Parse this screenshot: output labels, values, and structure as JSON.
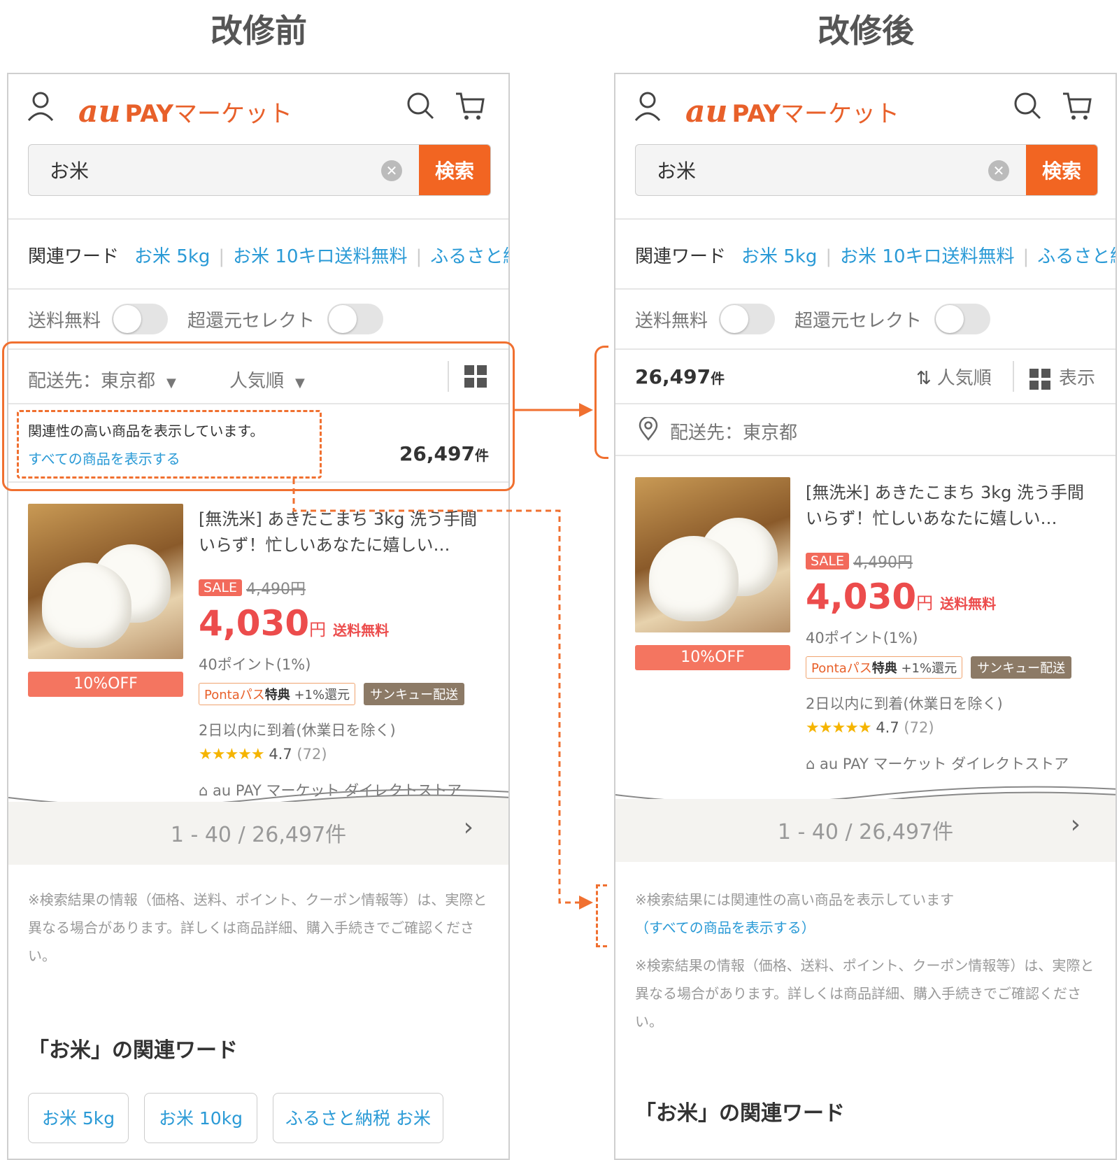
{
  "headings": {
    "before": "改修前",
    "after": "改修後"
  },
  "header": {
    "logo_au": "au",
    "logo_pay": "PAY",
    "logo_market": "マーケット"
  },
  "search": {
    "value": "お米",
    "button": "検索"
  },
  "related": {
    "label": "関連ワード",
    "links": [
      "お米 5kg",
      "お米 10キロ送料無料",
      "ふるさと納"
    ]
  },
  "filters": {
    "free_shipping": "送料無料",
    "super_select": "超還元セレクト"
  },
  "sort_bar": {
    "destination": "配送先：東京都",
    "sort": "人気順",
    "display": "表示",
    "count_num": "26,497",
    "count_unit": "件",
    "destination_label": "配送先：東京都"
  },
  "relevance": {
    "notice": "関連性の高い商品を表示しています。",
    "link": "すべての商品を表示する"
  },
  "product": {
    "title": "[無洗米] あきたこまち 3kg 洗う手間いらず！忙しいあなたに嬉しい…",
    "sale_badge": "SALE",
    "original_price": "4,490円",
    "price": "4,030",
    "yen": "円",
    "shipping": "送料無料",
    "points": "40ポイント(1%)",
    "discount": "10%OFF",
    "ponta_a": "Pontaパス",
    "ponta_b": "特典",
    "ponta_c": "+1%還元",
    "thanks": "サンキュー配送",
    "delivery": "2日以内に到着(休業日を除く)",
    "stars": "★★★★★",
    "rating": "4.7",
    "reviews": "(72)",
    "store": "au PAY マーケット ダイレクトストア"
  },
  "pager": {
    "text": "1 - 40 / 26,497件",
    "next": "›"
  },
  "notice_after": {
    "line1": "※検索結果には関連性の高い商品を表示しています",
    "link": "（すべての商品を表示する）"
  },
  "notice": {
    "text": "※検索結果の情報（価格、送料、ポイント、クーポン情報等）は、実際と異なる場合があります。詳しくは商品詳細、購入手続きでご確認ください。"
  },
  "related_section": {
    "title": "「お米」の関連ワード",
    "chips": [
      "お米 5kg",
      "お米 10kg",
      "ふるさと納税 お米"
    ]
  },
  "colors": {
    "accent": "#f26522",
    "link": "#2a9ad6",
    "price": "#ec4c4c",
    "annotation": "#f07030"
  }
}
